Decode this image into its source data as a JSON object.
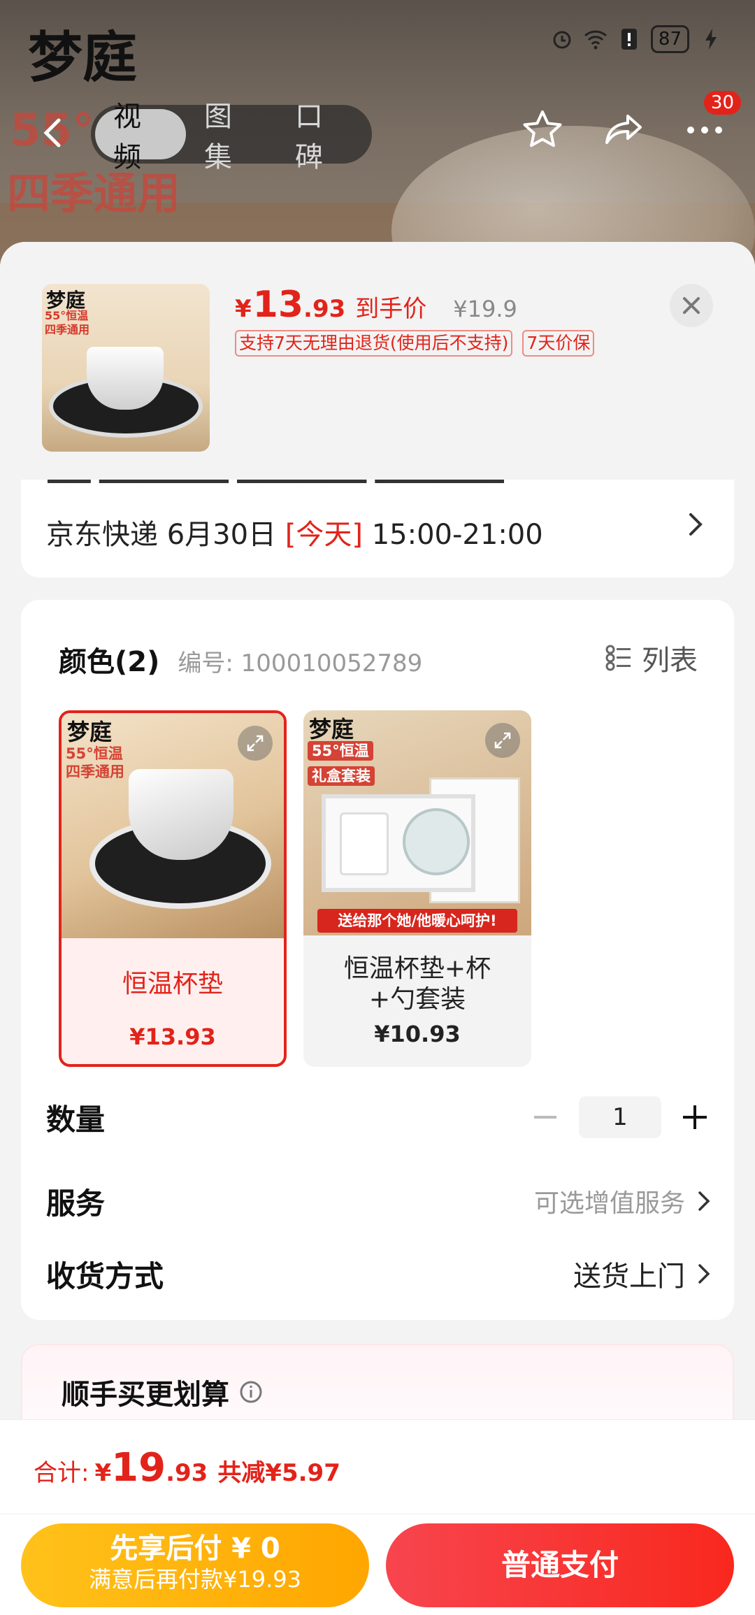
{
  "status_bar": {
    "battery": "87"
  },
  "background": {
    "brand": "梦庭",
    "banner_line1": "55°",
    "banner_line2": "四季通用",
    "tabs": [
      {
        "label": "视频",
        "active": true
      },
      {
        "label": "图集",
        "active": false
      },
      {
        "label": "口碑",
        "active": false
      }
    ],
    "cart_badge": "30"
  },
  "sheet": {
    "thumb": {
      "brand": "梦庭",
      "tag_line1": "55°恒温",
      "tag_line2": "四季通用"
    },
    "price": {
      "yen": "¥",
      "int": "13",
      "dec": ".93",
      "label": "到手价",
      "original": "¥19.9"
    },
    "tags": [
      "支持7天无理由退货(使用后不支持)",
      "7天价保"
    ],
    "delivery": {
      "prefix": "京东快递 6月30日",
      "today": "[今天]",
      "window": "15:00-21:00"
    },
    "spec": {
      "title": "颜色(2)",
      "code": "编号: 100010052789",
      "list_label": "列表",
      "options": [
        {
          "name": "恒温杯垫",
          "price": "¥13.93",
          "selected": true,
          "brand": "梦庭",
          "tag1": "55°恒温",
          "tag2": "四季通用"
        },
        {
          "name": "恒温杯垫+杯+勺套装",
          "price": "¥10.93",
          "selected": false,
          "brand": "梦庭",
          "tag1": "55°恒温",
          "tag2": "礼盒套装",
          "ribbon": "送给那个她/他暖心呵护!"
        }
      ]
    },
    "quantity": {
      "label": "数量",
      "value": "1"
    },
    "service": {
      "label": "服务",
      "value": "可选增值服务"
    },
    "shipping": {
      "label": "收货方式",
      "value": "送货上门"
    },
    "bundle": {
      "title": "顺手买更划算"
    }
  },
  "footer": {
    "total_label": "合计:",
    "total_yen": "¥",
    "total_int": "19",
    "total_dec": ".93",
    "total_save": "共减¥5.97",
    "btn_later_line1": "先享后付 ¥ 0",
    "btn_later_line2": "满意后再付款¥19.93",
    "btn_pay": "普通支付"
  },
  "colors": {
    "accent": "#e2231a",
    "later_btn": "#ffb400",
    "pay_btn": "#f7363a"
  }
}
